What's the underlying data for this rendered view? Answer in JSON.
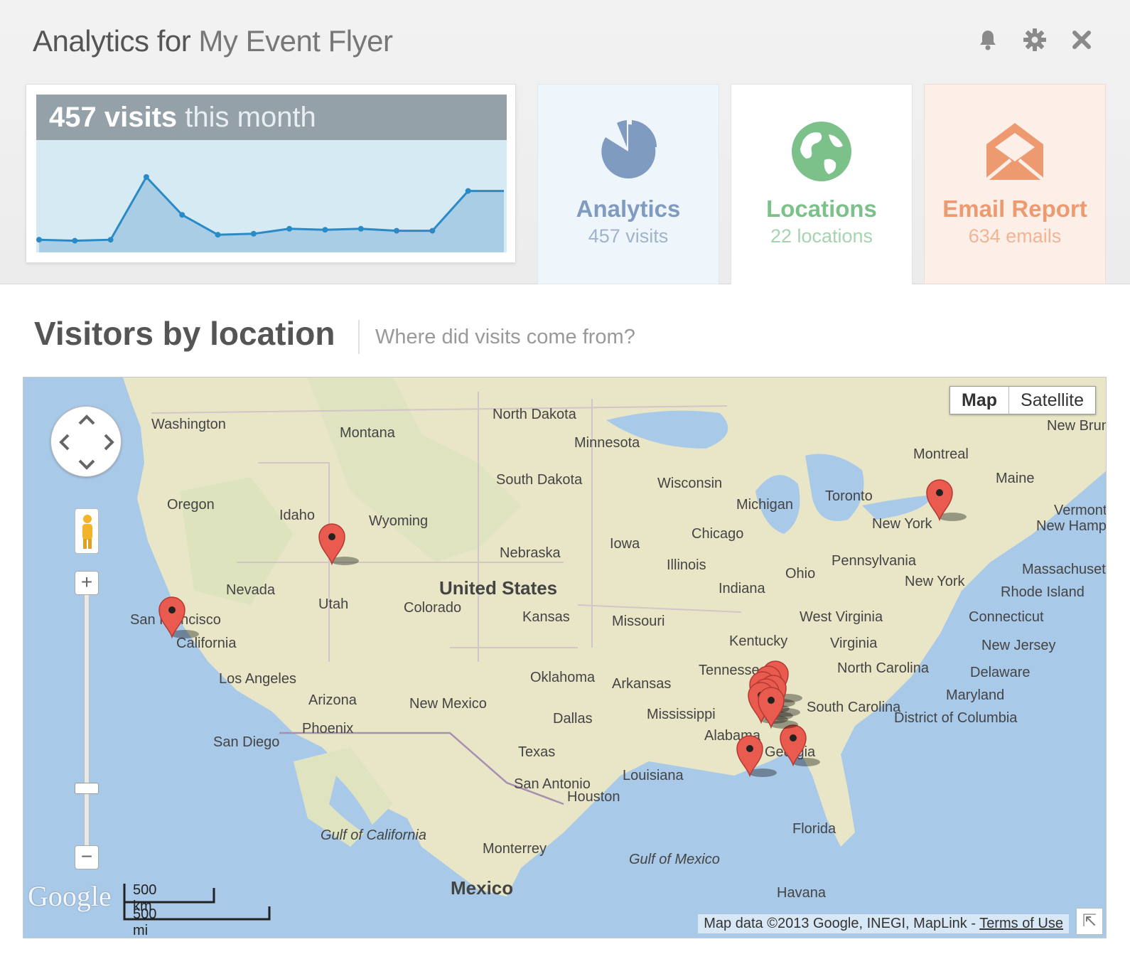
{
  "header": {
    "title_prefix": "Analytics for",
    "document_name": "My Event Flyer",
    "icons": [
      "bell-icon",
      "gear-icon",
      "close-icon"
    ]
  },
  "visits_card": {
    "count": "457 visits",
    "period": "this month"
  },
  "sparkline": {
    "type": "area",
    "values": [
      7,
      6,
      7,
      70,
      32,
      12,
      13,
      18,
      17,
      18,
      16,
      16,
      56,
      56
    ],
    "ylim": [
      0,
      100
    ],
    "line_color": "#2a8ac6",
    "fill_color": "#aacde6"
  },
  "tiles": [
    {
      "label": "Analytics",
      "sub": "457 visits",
      "icon": "pie-chart-icon",
      "color": "#7f9bbf"
    },
    {
      "label": "Locations",
      "sub": "22 locations",
      "icon": "globe-icon",
      "color": "#7cc08a"
    },
    {
      "label": "Email Report",
      "sub": "634 emails",
      "icon": "envelope-open-icon",
      "color": "#ee9a70"
    }
  ],
  "section": {
    "title": "Visitors by location",
    "subtitle": "Where did visits come from?"
  },
  "map": {
    "type_buttons": [
      "Map",
      "Satellite"
    ],
    "logo": "Google",
    "scale_km": "500 km",
    "scale_mi": "500 mi",
    "attribution": "Map data ©2013 Google, INEGI, MapLink -",
    "terms": "Terms of Use",
    "labels": [
      "Washington",
      "Montana",
      "North Dakota",
      "Minnesota",
      "Oregon",
      "Idaho",
      "Wyoming",
      "South Dakota",
      "Wisconsin",
      "Michigan",
      "Toronto",
      "Montreal",
      "Maine",
      "New Brunswick",
      "Nevada",
      "Utah",
      "Nebraska",
      "Iowa",
      "Chicago",
      "Illinois",
      "Indiana",
      "Ohio",
      "Pennsylvania",
      "New York",
      "New York",
      "San Francisco",
      "California",
      "United States",
      "Colorado",
      "Kansas",
      "Missouri",
      "Kentucky",
      "West Virginia",
      "Virginia",
      "Los Angeles",
      "Arizona",
      "New Mexico",
      "Oklahoma",
      "Arkansas",
      "Tennessee",
      "North Carolina",
      "Phoenix",
      "San Diego",
      "Dallas",
      "Mississippi",
      "Alabama",
      "South Carolina",
      "Georgia",
      "Texas",
      "Louisiana",
      "San Antonio",
      "Houston",
      "Florida",
      "Gulf of California",
      "Monterrey",
      "Gulf of Mexico",
      "Mexico",
      "Havana",
      "Vermont",
      "New Hampshire",
      "Massachusetts",
      "Rhode Island",
      "Connecticut",
      "New Jersey",
      "Delaware",
      "Maryland",
      "District of Columbia"
    ],
    "marker_color": "#e95a4f",
    "marker_count_shown": 12
  },
  "colors": {
    "land": "#e9e6c7",
    "water": "#a9c9e8",
    "accent_blue": "#7f9bbf",
    "accent_green": "#7cc08a",
    "accent_orange": "#ee9a70"
  }
}
